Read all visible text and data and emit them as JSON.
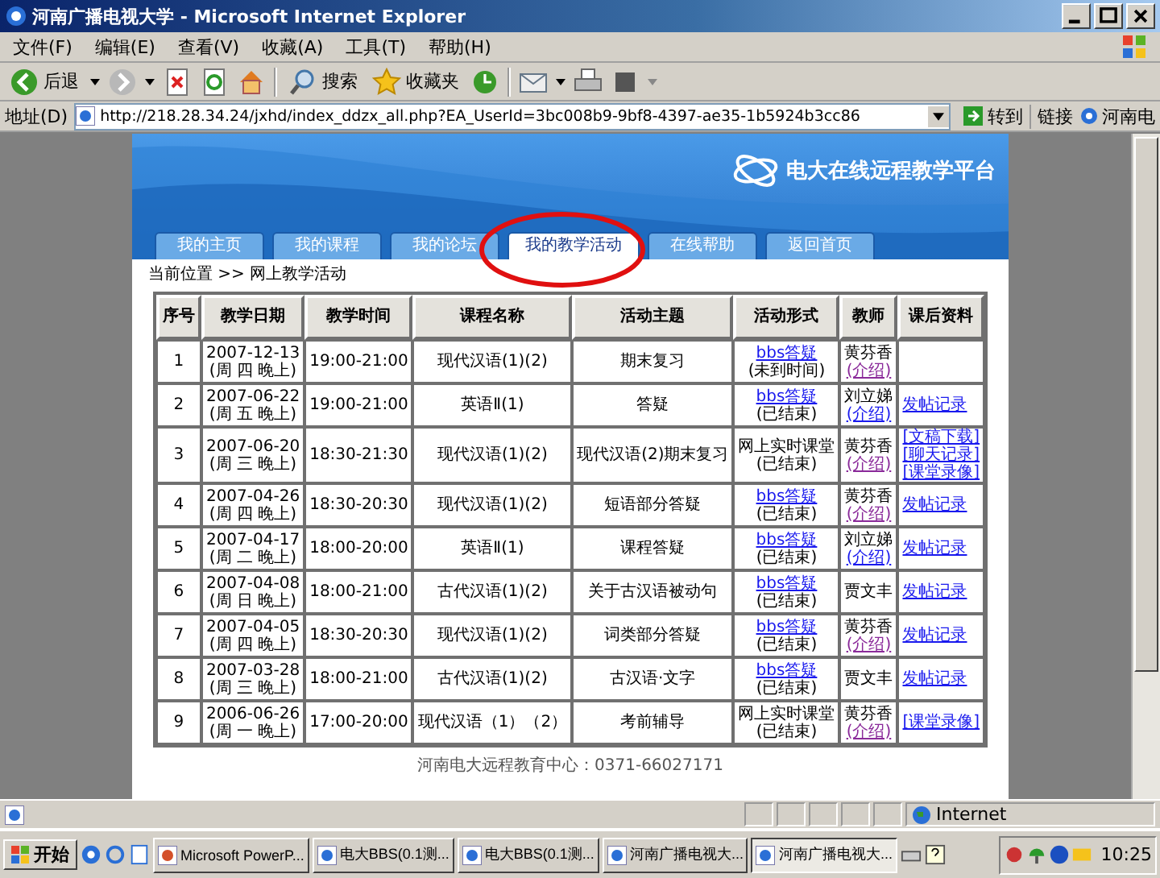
{
  "window": {
    "title": "河南广播电视大学 - Microsoft Internet Explorer"
  },
  "menu": [
    "文件(F)",
    "编辑(E)",
    "查看(V)",
    "收藏(A)",
    "工具(T)",
    "帮助(H)"
  ],
  "toolbar": {
    "back": "后退",
    "search": "搜索",
    "favorites": "收藏夹"
  },
  "address_bar": {
    "label": "地址(D)",
    "url": "http://218.28.34.24/jxhd/index_ddzx_all.php?EA_UserId=3bc008b9-9bf8-4397-ae35-1b5924b3cc86",
    "go": "转到",
    "links": "链接",
    "link_item": "河南电"
  },
  "page": {
    "logo": "电大在线远程教学平台",
    "tabs": [
      {
        "label": "我的主页",
        "selected": false
      },
      {
        "label": "我的课程",
        "selected": false
      },
      {
        "label": "我的论坛",
        "selected": false
      },
      {
        "label": "我的教学活动",
        "selected": true
      },
      {
        "label": "在线帮助",
        "selected": false
      },
      {
        "label": "返回首页",
        "selected": false
      }
    ],
    "breadcrumb": "当前位置 >> 网上教学活动",
    "table": {
      "columns": [
        "序号",
        "教学日期",
        "教学时间",
        "课程名称",
        "活动主题",
        "活动形式",
        "教师",
        "课后资料"
      ],
      "rows": [
        {
          "no": "1",
          "date": "2007-12-13",
          "day": "(周 四 晚上)",
          "time": "19:00-21:00",
          "course": "现代汉语(1)(2)",
          "topic": "期末复习",
          "activity": {
            "kind": "link",
            "label": "bbs答疑",
            "status": "(未到时间)"
          },
          "teacher": {
            "name": "黄芬香",
            "intro": {
              "label": "(介绍)",
              "visited": true
            }
          },
          "materials": []
        },
        {
          "no": "2",
          "date": "2007-06-22",
          "day": "(周 五 晚上)",
          "time": "19:00-21:00",
          "course": "英语Ⅱ(1)",
          "topic": "答疑",
          "activity": {
            "kind": "link",
            "label": "bbs答疑",
            "status": "(已结束)"
          },
          "teacher": {
            "name": "刘立娣",
            "intro": {
              "label": "(介绍)",
              "visited": false
            }
          },
          "materials": [
            "发帖记录"
          ]
        },
        {
          "no": "3",
          "date": "2007-06-20",
          "day": "(周 三 晚上)",
          "time": "18:30-21:30",
          "course": "现代汉语(1)(2)",
          "topic": "现代汉语(2)期末复习",
          "activity": {
            "kind": "text",
            "label": "网上实时课堂",
            "status": "(已结束)"
          },
          "teacher": {
            "name": "黄芬香",
            "intro": {
              "label": "(介绍)",
              "visited": true
            }
          },
          "materials": [
            "[文稿下载]",
            "[聊天记录]",
            "[课堂录像]"
          ]
        },
        {
          "no": "4",
          "date": "2007-04-26",
          "day": "(周 四 晚上)",
          "time": "18:30-20:30",
          "course": "现代汉语(1)(2)",
          "topic": "短语部分答疑",
          "activity": {
            "kind": "link",
            "label": "bbs答疑",
            "status": "(已结束)"
          },
          "teacher": {
            "name": "黄芬香",
            "intro": {
              "label": "(介绍)",
              "visited": true
            }
          },
          "materials": [
            "发帖记录"
          ]
        },
        {
          "no": "5",
          "date": "2007-04-17",
          "day": "(周 二 晚上)",
          "time": "18:00-20:00",
          "course": "英语Ⅱ(1)",
          "topic": "课程答疑",
          "activity": {
            "kind": "link",
            "label": "bbs答疑",
            "status": "(已结束)"
          },
          "teacher": {
            "name": "刘立娣",
            "intro": {
              "label": "(介绍)",
              "visited": false
            }
          },
          "materials": [
            "发帖记录"
          ]
        },
        {
          "no": "6",
          "date": "2007-04-08",
          "day": "(周 日 晚上)",
          "time": "18:00-21:00",
          "course": "古代汉语(1)(2)",
          "topic": "关于古汉语被动句",
          "activity": {
            "kind": "link",
            "label": "bbs答疑",
            "status": "(已结束)"
          },
          "teacher": {
            "name": "贾文丰"
          },
          "materials": [
            "发帖记录"
          ]
        },
        {
          "no": "7",
          "date": "2007-04-05",
          "day": "(周 四 晚上)",
          "time": "18:30-20:30",
          "course": "现代汉语(1)(2)",
          "topic": "词类部分答疑",
          "activity": {
            "kind": "link",
            "label": "bbs答疑",
            "status": "(已结束)"
          },
          "teacher": {
            "name": "黄芬香",
            "intro": {
              "label": "(介绍)",
              "visited": true
            }
          },
          "materials": [
            "发帖记录"
          ]
        },
        {
          "no": "8",
          "date": "2007-03-28",
          "day": "(周 三 晚上)",
          "time": "18:00-21:00",
          "course": "古代汉语(1)(2)",
          "topic": "古汉语·文字",
          "activity": {
            "kind": "link",
            "label": "bbs答疑",
            "status": "(已结束)"
          },
          "teacher": {
            "name": "贾文丰"
          },
          "materials": [
            "发帖记录"
          ]
        },
        {
          "no": "9",
          "date": "2006-06-26",
          "day": "(周 一 晚上)",
          "time": "17:00-20:00",
          "course": "现代汉语（1）（2）",
          "topic": "考前辅导",
          "activity": {
            "kind": "text",
            "label": "网上实时课堂",
            "status": "(已结束)"
          },
          "teacher": {
            "name": "黄芬香",
            "intro": {
              "label": "(介绍)",
              "visited": true
            }
          },
          "materials": [
            "[课堂录像]"
          ]
        }
      ]
    },
    "footer": "河南电大远程教育中心：0371-66027171"
  },
  "status_bar": {
    "zone": "Internet"
  },
  "taskbar": {
    "start": "开始",
    "items": [
      {
        "label": "Microsoft PowerP...",
        "selected": false
      },
      {
        "label": "电大BBS(0.1测...",
        "selected": false
      },
      {
        "label": "电大BBS(0.1测...",
        "selected": false
      },
      {
        "label": "河南广播电视大...",
        "selected": false
      },
      {
        "label": "河南广播电视大...",
        "selected": true
      }
    ],
    "clock": "10:25"
  }
}
